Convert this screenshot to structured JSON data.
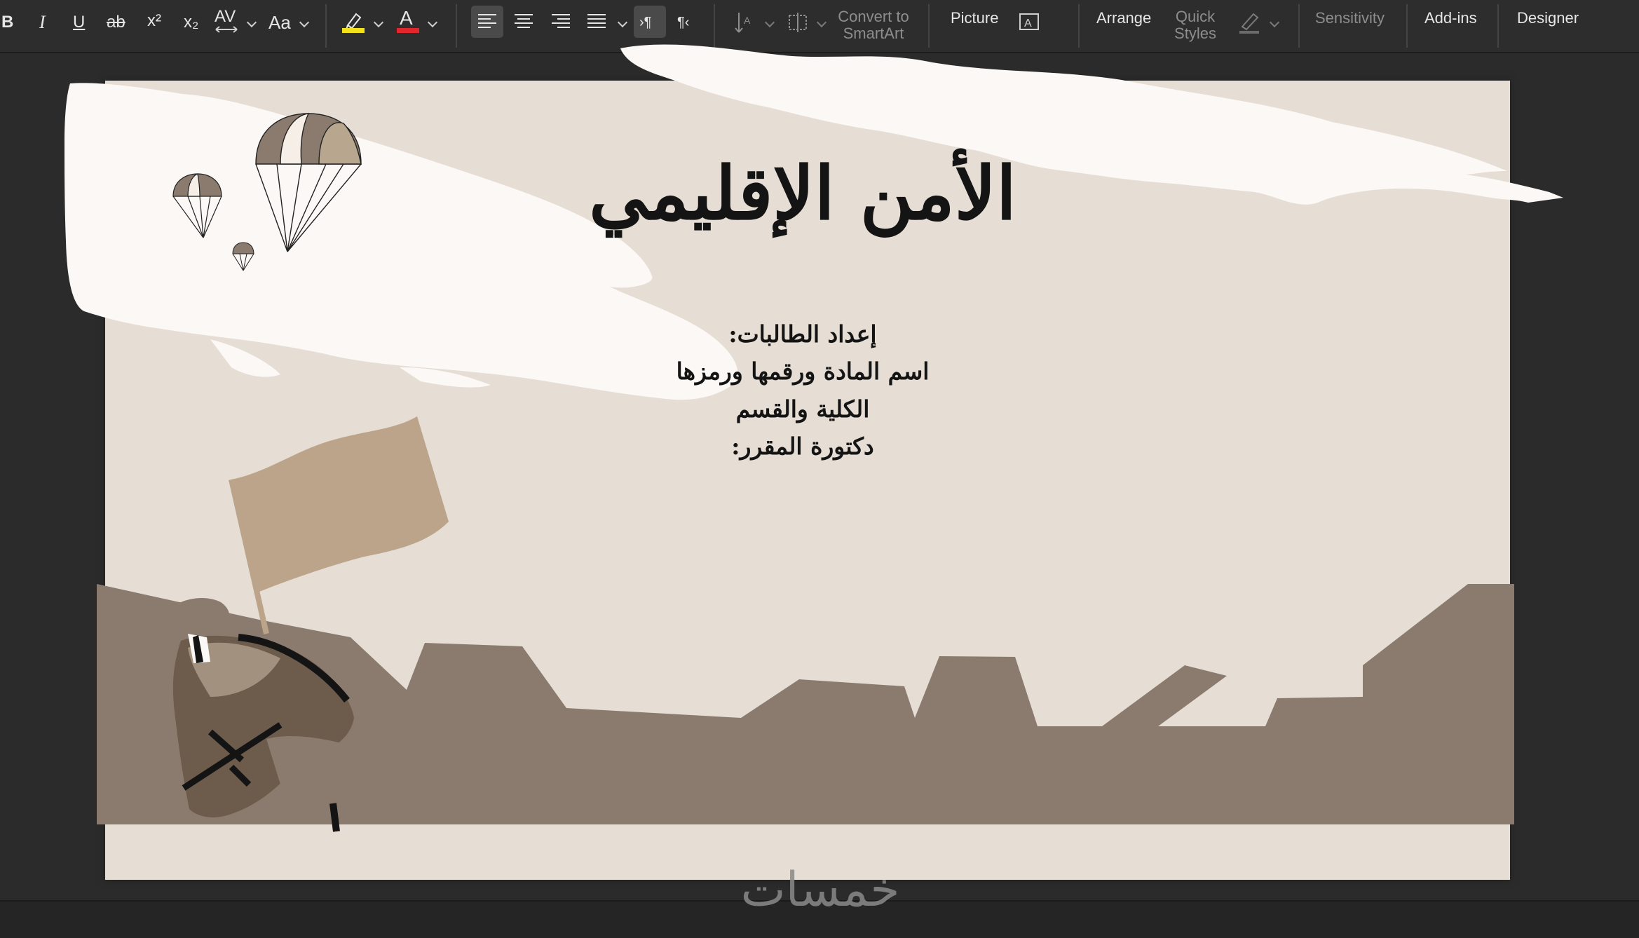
{
  "toolbar": {
    "format": {
      "bold": "B",
      "italic": "I",
      "underline": "U",
      "strikethrough": "ab",
      "superscript": "x²",
      "subscript": "x₂",
      "char_spacing": "AV",
      "change_case": "Aa"
    },
    "paragraph": {
      "ltr_label": "›¶",
      "rtl_label": "¶‹"
    },
    "convert_smartart": "Convert to SmartArt",
    "convert_smartart_lines": [
      "Convert to",
      "SmartArt"
    ],
    "picture": "Picture",
    "arrange": "Arrange",
    "quick_styles_lines": [
      "Quick",
      "Styles"
    ],
    "sensitivity": "Sensitivity",
    "add_ins": "Add-ins",
    "designer": "Designer",
    "colors": {
      "highlight": "#f2e21b",
      "font_color": "#e3262b"
    }
  },
  "slide": {
    "title": "الأمن الإقليمي",
    "lines": [
      "إعداد الطالبات:",
      "اسم المادة ورقمها ورمزها",
      "الكلية والقسم",
      "دكتورة المقرر:"
    ],
    "colors": {
      "background": "#e6ddd4",
      "cloud": "#fbf8f5",
      "ground": "#8a7b6e",
      "flag": "#bba48a",
      "soldier": "#6d5b4b"
    }
  },
  "watermark": {
    "text": "خمسات"
  }
}
